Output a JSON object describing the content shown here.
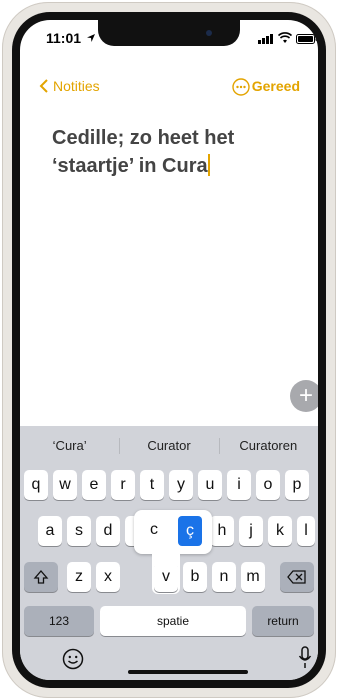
{
  "status": {
    "time": "11:01"
  },
  "nav": {
    "back_label": "Notities",
    "done_label": "Gereed"
  },
  "note": {
    "line1": "Cedille; zo heet het",
    "line2": "‘staartje’ in Cura"
  },
  "suggestions": [
    "‘Cura’",
    "Curator",
    "Curatoren"
  ],
  "keys": {
    "row1": [
      "q",
      "w",
      "e",
      "r",
      "t",
      "y",
      "u",
      "i",
      "o",
      "p"
    ],
    "row2": [
      "a",
      "s",
      "d",
      "f",
      "g",
      "h",
      "j",
      "k",
      "l"
    ],
    "row3": [
      "z",
      "x",
      "c",
      "v",
      "b",
      "n",
      "m"
    ],
    "numbers": "123",
    "space": "spatie",
    "return": "return"
  },
  "popup": {
    "option1": "c",
    "option2": "ç"
  },
  "colors": {
    "accent": "#e3a400",
    "selected": "#1a73e8",
    "keyboard_bg": "#d1d3d9"
  },
  "icons": [
    "location-arrow-icon",
    "signal-icon",
    "wifi-icon",
    "battery-icon",
    "chevron-left-icon",
    "more-icon",
    "plus-icon",
    "shift-icon",
    "backspace-icon",
    "emoji-icon",
    "microphone-icon"
  ]
}
